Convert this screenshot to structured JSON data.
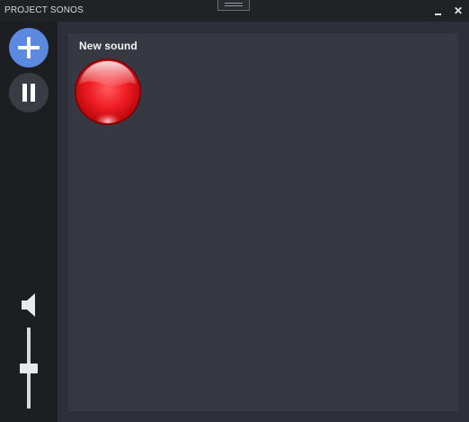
{
  "window": {
    "title": "PROJECT SONOS",
    "minimize_symbol": "_",
    "close_symbol": "✕"
  },
  "sidebar": {
    "add_icon": "plus-icon",
    "pause_icon": "pause-icon",
    "volume_icon": "speaker-icon",
    "volume_level": 0.5
  },
  "sounds": [
    {
      "name": "New sound",
      "color": "#e0171c"
    }
  ],
  "colors": {
    "accent": "#5b89e0",
    "sidebar": "#1d1e22",
    "titlebar": "#212226",
    "canvas": "#363942",
    "orb": "#e0171c"
  }
}
